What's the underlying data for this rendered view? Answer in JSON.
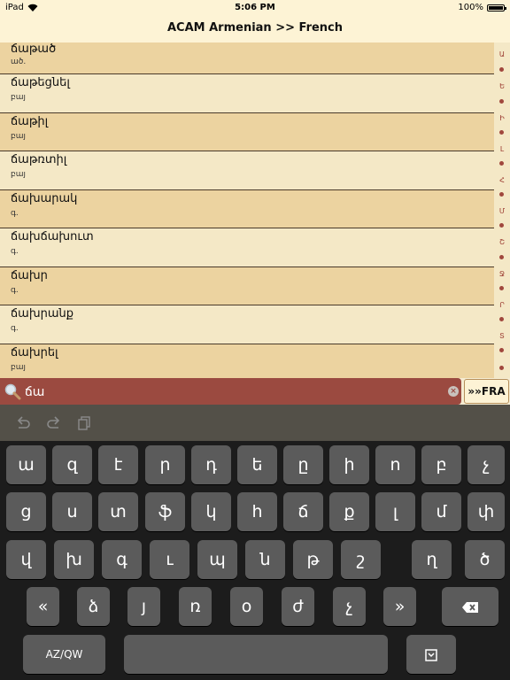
{
  "status_bar": {
    "carrier": "iPad",
    "time": "5:06 PM",
    "battery": "100%"
  },
  "nav": {
    "title": "ACAM Armenian >> French"
  },
  "list": [
    {
      "word": "ճաթած",
      "pos": "ած."
    },
    {
      "word": "ճաթեցնել",
      "pos": "բայ"
    },
    {
      "word": "ճաթիլ",
      "pos": "բայ"
    },
    {
      "word": "ճաթռտիլ",
      "pos": "բայ"
    },
    {
      "word": "ճախարակ",
      "pos": "գ."
    },
    {
      "word": "ճախճախուտ",
      "pos": "գ."
    },
    {
      "word": "ճախր",
      "pos": "գ."
    },
    {
      "word": "ճախրանք",
      "pos": "գ."
    },
    {
      "word": "ճախրել",
      "pos": "բայ"
    }
  ],
  "index": [
    "Ա",
    "Ե",
    "Ի",
    "Լ",
    "Հ",
    "Մ",
    "Շ",
    "Ջ",
    "Ր",
    "Տ"
  ],
  "search": {
    "value": "ճա",
    "language_button": "»»FRA"
  },
  "keyboard": {
    "row1": [
      "ա",
      "զ",
      "է",
      "ր",
      "դ",
      "ե",
      "ը",
      "ի",
      "ո",
      "բ",
      "չ"
    ],
    "row2": [
      "ց",
      "ս",
      "տ",
      "ֆ",
      "կ",
      "հ",
      "ճ",
      "ք",
      "լ",
      "մ",
      "փ"
    ],
    "row3": [
      "վ",
      "խ",
      "գ",
      "ւ",
      "պ",
      "ն",
      "թ",
      "շ",
      "ղ",
      "ծ"
    ],
    "row4": [
      "«",
      "ձ",
      "յ",
      "ռ",
      "օ",
      "ժ",
      "չ",
      "»"
    ],
    "layout_switch": "AZ/QW"
  },
  "colors": {
    "accent": "#9b4a40",
    "row_odd": "#ecd3a0",
    "row_even": "#f4e8c6",
    "keyboard": "#1c1c1c"
  }
}
